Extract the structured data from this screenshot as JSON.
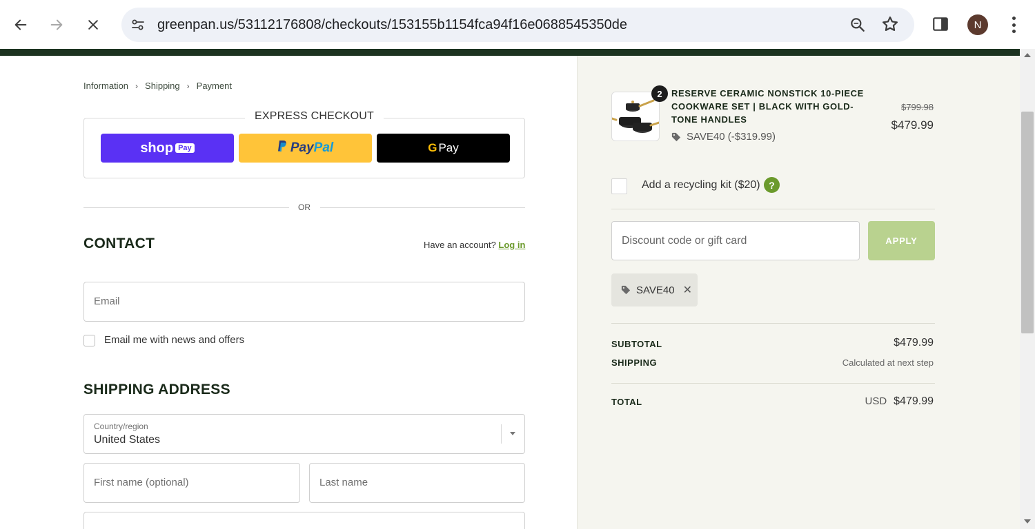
{
  "browser": {
    "url": "greenpan.us/53112176808/checkouts/153155b1154fca94f16e0688545350de",
    "avatar_initial": "N"
  },
  "breadcrumb": [
    "Information",
    "Shipping",
    "Payment"
  ],
  "express": {
    "title": "EXPRESS CHECKOUT",
    "shop_pay": {
      "shop": "shop",
      "pay": "Pay"
    },
    "paypal": {
      "pay": "Pay",
      "pal": "Pal"
    },
    "gpay": {
      "g": "G",
      "pay": "Pay"
    }
  },
  "or_text": "OR",
  "contact": {
    "heading": "CONTACT",
    "have_account": "Have an account?",
    "login": "Log in",
    "email_placeholder": "Email",
    "news_label": "Email me with news and offers"
  },
  "shipping": {
    "heading": "SHIPPING ADDRESS",
    "country_label": "Country/region",
    "country_value": "United States",
    "first_name_placeholder": "First name (optional)",
    "last_name_placeholder": "Last name"
  },
  "summary": {
    "product": {
      "quantity": "2",
      "title": "RESERVE CERAMIC NONSTICK 10-PIECE COOKWARE SET | BLACK WITH GOLD-TONE HANDLES",
      "discount": "SAVE40 (-$319.99)",
      "price_original": "$799.98",
      "price_final": "$479.99"
    },
    "recycling_label": "Add a recycling kit ($20)",
    "help_symbol": "?",
    "discount_placeholder": "Discount code or gift card",
    "apply_label": "APPLY",
    "applied_code": "SAVE40",
    "remove_symbol": "✕",
    "subtotal_label": "SUBTOTAL",
    "subtotal_value": "$479.99",
    "shipping_label": "SHIPPING",
    "shipping_value": "Calculated at next step",
    "total_label": "TOTAL",
    "total_currency": "USD",
    "total_value": "$479.99"
  },
  "colors": {
    "brand_dark_green": "#1c3320",
    "accent_green": "#6b9a2c",
    "apply_disabled": "#b9d28f",
    "shop_pay": "#5a31f4",
    "paypal": "#ffc439"
  }
}
